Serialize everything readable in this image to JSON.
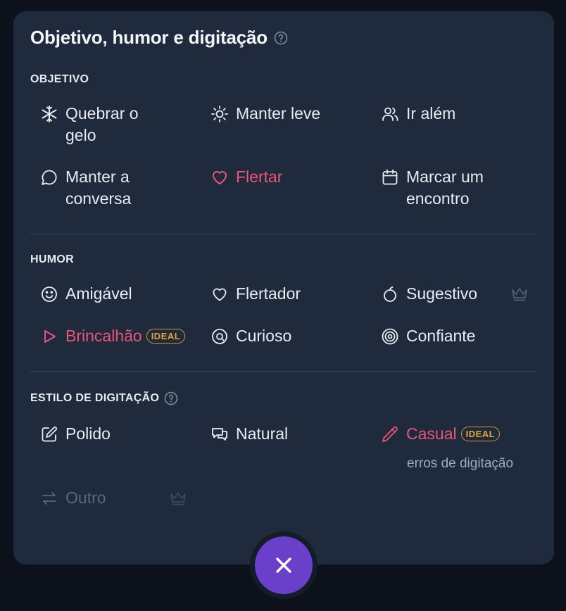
{
  "title": "Objetivo, humor e digitação",
  "sections": {
    "objetivo": {
      "label": "OBJETIVO",
      "items": [
        {
          "label_line1": "Quebrar o",
          "label_line2": "gelo",
          "icon": "snowflake-icon"
        },
        {
          "label": "Manter leve",
          "icon": "sun-icon"
        },
        {
          "label": "Ir além",
          "icon": "users-icon"
        },
        {
          "label_line1": "Manter a",
          "label_line2": "conversa",
          "icon": "chat-bubble-icon"
        },
        {
          "label": "Flertar",
          "icon": "heart-icon",
          "selected": true
        },
        {
          "label_line1": "Marcar um",
          "label_line2": "encontro",
          "icon": "calendar-icon"
        }
      ]
    },
    "humor": {
      "label": "HUMOR",
      "items": [
        {
          "label": "Amigável",
          "icon": "smile-icon"
        },
        {
          "label": "Flertador",
          "icon": "heart-outline-icon"
        },
        {
          "label": "Sugestivo",
          "icon": "peach-icon",
          "premium": true
        },
        {
          "label": "Brincalhão",
          "icon": "play-icon",
          "selected": true,
          "badge": "IDEAL"
        },
        {
          "label": "Curioso",
          "icon": "at-icon"
        },
        {
          "label": "Confiante",
          "icon": "target-icon"
        }
      ]
    },
    "estilo": {
      "label": "ESTILO DE DIGITAÇÃO",
      "items": [
        {
          "label": "Polido",
          "icon": "edit-icon"
        },
        {
          "label": "Natural",
          "icon": "chat-bubbles-icon"
        },
        {
          "label": "Casual",
          "icon": "pencil-icon",
          "selected": true,
          "badge": "IDEAL",
          "sublabel": "erros de digitação"
        },
        {
          "label": "Outro",
          "icon": "swap-icon",
          "disabled": true,
          "premium": true
        }
      ]
    }
  },
  "colors": {
    "panel": "#1f2a3c",
    "selected": "#ea5479",
    "badge": "#e6a52b",
    "close_button": "#6a3fca"
  }
}
